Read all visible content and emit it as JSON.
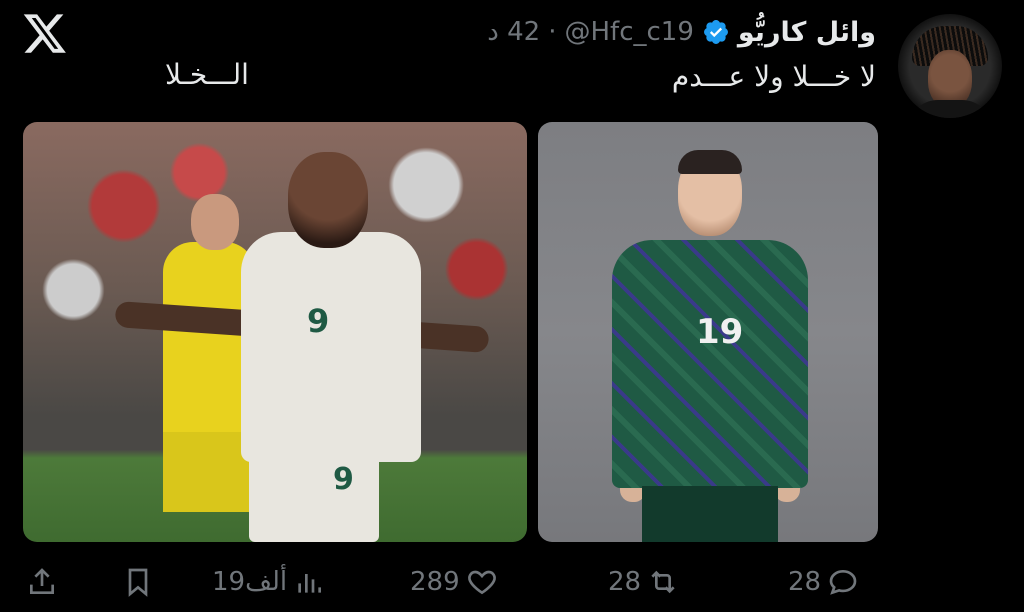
{
  "tweet": {
    "display_name": "وائل كاريُّو",
    "handle": "@Hfc_c19",
    "separator": "·",
    "time": "42 د",
    "text": "لا خـــلا ولا عـــدم",
    "image_caption": "الـــخـلا"
  },
  "actions": {
    "replies": "28",
    "retweets": "28",
    "likes": "289",
    "views": "19ألف"
  },
  "images": {
    "right_jersey_number": "19",
    "left_jersey_number": "9",
    "left_shorts_number": "9"
  },
  "colors": {
    "background": "#000000",
    "text_primary": "#e7e9ea",
    "text_secondary": "#71767b",
    "verified": "#1d9bf0",
    "jersey_green": "#1f5a44",
    "jersey_white": "#e8e6df"
  },
  "icons": {
    "logo": "x-logo-icon",
    "verified": "verified-badge-icon",
    "reply": "reply-icon",
    "retweet": "retweet-icon",
    "like": "heart-icon",
    "views": "views-chart-icon",
    "bookmark": "bookmark-icon",
    "share": "share-icon"
  }
}
